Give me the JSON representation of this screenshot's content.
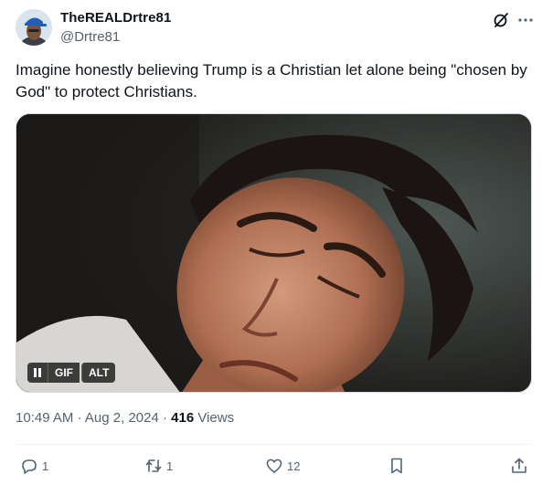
{
  "author": {
    "display_name": "TheREALDrtre81",
    "handle": "@Drtre81"
  },
  "tweet": {
    "text": "Imagine honestly believing Trump is a Christian let alone being \"chosen by God\" to protect Christians."
  },
  "media": {
    "type": "GIF",
    "gif_label": "GIF",
    "alt_label": "ALT"
  },
  "meta": {
    "time": "10:49 AM",
    "separator": "·",
    "date": "Aug 2, 2024",
    "views_count": "416",
    "views_label": "Views"
  },
  "actions": {
    "replies": "1",
    "reposts": "1",
    "likes": "12"
  },
  "icons": {
    "header": [
      "grok-icon",
      "more-icon"
    ],
    "media": [
      "pause-icon"
    ],
    "actions": [
      "reply-icon",
      "repost-icon",
      "like-icon",
      "bookmark-icon",
      "share-icon"
    ]
  },
  "colors": {
    "text": "#0f1419",
    "secondary": "#536471",
    "divider": "#eff3f4"
  }
}
